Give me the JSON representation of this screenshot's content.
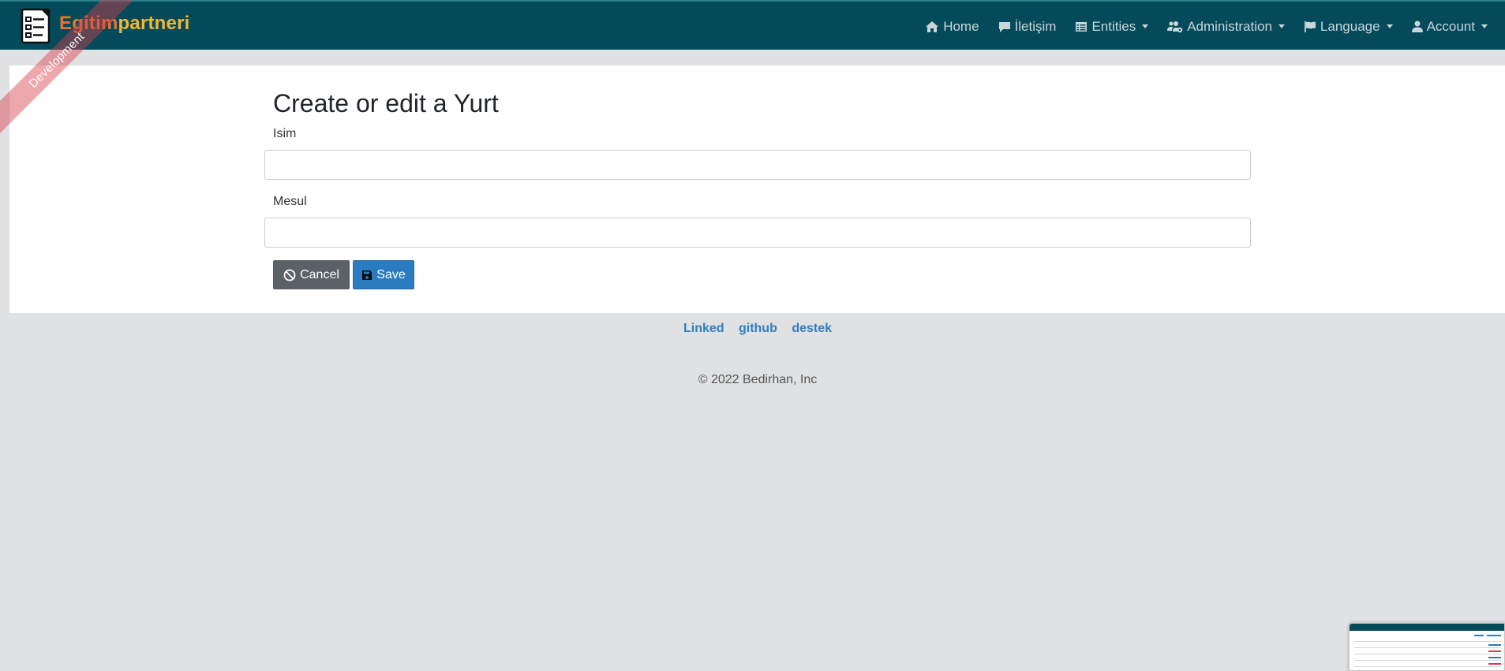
{
  "navbar": {
    "brand_part1": "Egitim",
    "brand_part2": "partneri",
    "items": [
      {
        "label": "Home",
        "icon": "home-icon",
        "dropdown": false
      },
      {
        "label": "İletişim",
        "icon": "comment-icon",
        "dropdown": false
      },
      {
        "label": "Entities",
        "icon": "table-list-icon",
        "dropdown": true
      },
      {
        "label": "Administration",
        "icon": "users-cog-icon",
        "dropdown": true
      },
      {
        "label": "Language",
        "icon": "flag-icon",
        "dropdown": true
      },
      {
        "label": "Account",
        "icon": "user-icon",
        "dropdown": true
      }
    ]
  },
  "ribbon": {
    "label": "Development"
  },
  "form": {
    "title": "Create or edit a Yurt",
    "fields": [
      {
        "label": "Isim",
        "value": "",
        "placeholder": ""
      },
      {
        "label": "Mesul",
        "value": "",
        "placeholder": ""
      }
    ],
    "cancel_label": "Cancel",
    "save_label": "Save"
  },
  "footer": {
    "links": [
      "Linked",
      "github",
      "destek"
    ],
    "copyright": "© 2022 Bedirhan, Inc"
  },
  "colors": {
    "navbar_bg": "#044a5a",
    "brand_orange": "#e6762f",
    "brand_yellow": "#f6b632",
    "save_blue": "#2a7bc0",
    "cancel_gray": "#5a6268",
    "link_blue": "#2f7fc1",
    "page_bg": "#e0e1e3"
  }
}
